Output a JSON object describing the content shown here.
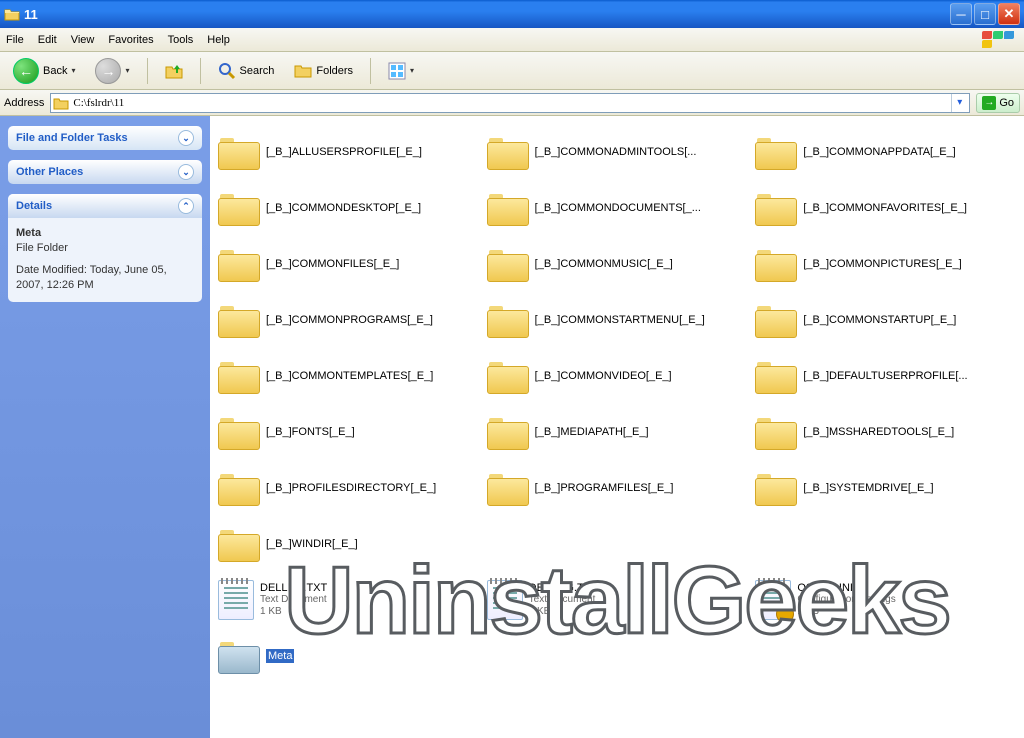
{
  "window": {
    "title": "11"
  },
  "menu": {
    "file": "File",
    "edit": "Edit",
    "view": "View",
    "favorites": "Favorites",
    "tools": "Tools",
    "help": "Help"
  },
  "toolbar": {
    "back": "Back",
    "search": "Search",
    "folders": "Folders"
  },
  "address": {
    "label": "Address",
    "path": "C:\\fslrdr\\11",
    "go": "Go"
  },
  "sidebar": {
    "tasks": {
      "title": "File and Folder Tasks"
    },
    "places": {
      "title": "Other Places"
    },
    "details": {
      "title": "Details",
      "name": "Meta",
      "type": "File Folder",
      "modified": "Date Modified: Today, June 05, 2007, 12:26 PM"
    }
  },
  "items": [
    {
      "type": "folder",
      "label": "[_B_]ALLUSERSPROFILE[_E_]"
    },
    {
      "type": "folder",
      "label": "[_B_]COMMONADMINTOOLS[..."
    },
    {
      "type": "folder",
      "label": "[_B_]COMMONAPPDATA[_E_]"
    },
    {
      "type": "folder",
      "label": "[_B_]COMMONDESKTOP[_E_]"
    },
    {
      "type": "folder",
      "label": "[_B_]COMMONDOCUMENTS[_..."
    },
    {
      "type": "folder",
      "label": "[_B_]COMMONFAVORITES[_E_]"
    },
    {
      "type": "folder",
      "label": "[_B_]COMMONFILES[_E_]"
    },
    {
      "type": "folder",
      "label": "[_B_]COMMONMUSIC[_E_]"
    },
    {
      "type": "folder",
      "label": "[_B_]COMMONPICTURES[_E_]"
    },
    {
      "type": "folder",
      "label": "[_B_]COMMONPROGRAMS[_E_]"
    },
    {
      "type": "folder",
      "label": "[_B_]COMMONSTARTMENU[_E_]"
    },
    {
      "type": "folder",
      "label": "[_B_]COMMONSTARTUP[_E_]"
    },
    {
      "type": "folder",
      "label": "[_B_]COMMONTEMPLATES[_E_]"
    },
    {
      "type": "folder",
      "label": "[_B_]COMMONVIDEO[_E_]"
    },
    {
      "type": "folder",
      "label": "[_B_]DEFAULTUSERPROFILE[..."
    },
    {
      "type": "folder",
      "label": "[_B_]FONTS[_E_]"
    },
    {
      "type": "folder",
      "label": "[_B_]MEDIAPATH[_E_]"
    },
    {
      "type": "folder",
      "label": "[_B_]MSSHAREDTOOLS[_E_]"
    },
    {
      "type": "folder",
      "label": "[_B_]PROFILESDIRECTORY[_E_]"
    },
    {
      "type": "folder",
      "label": "[_B_]PROGRAMFILES[_E_]"
    },
    {
      "type": "folder",
      "label": "[_B_]SYSTEMDRIVE[_E_]"
    },
    {
      "type": "folder",
      "label": "[_B_]WINDIR[_E_]"
    },
    {
      "type": "txt",
      "label": "DELLIST.TXT",
      "sub1": "Text Document",
      "sub2": "1 KB"
    },
    {
      "type": "txt",
      "label": "DELREG.TXT",
      "sub1": "Text Document",
      "sub2": "1 KB"
    },
    {
      "type": "ini",
      "label": "OSVER.INI",
      "sub1": "Configuration Settings",
      "sub2": "1 KB"
    },
    {
      "type": "folder-open",
      "label": "Meta",
      "selected": true
    }
  ],
  "watermark": "UninstallGeeks"
}
